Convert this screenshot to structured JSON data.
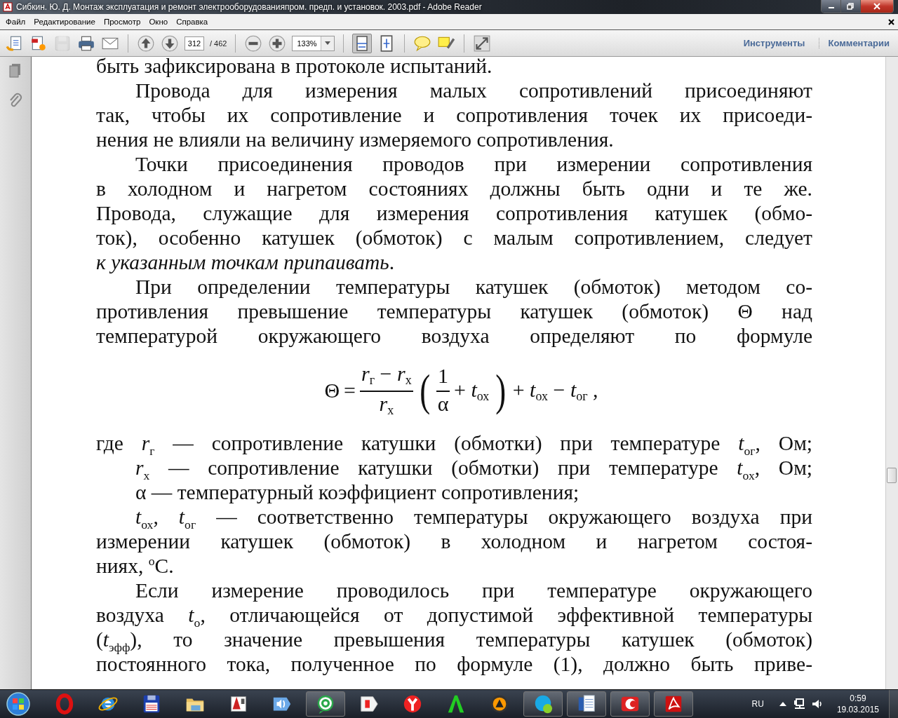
{
  "window": {
    "title": "Сибкин. Ю. Д. Монтаж эксплуатация и ремонт электрооборудованияпром. предп. и установок. 2003.pdf - Adobe Reader"
  },
  "menu": [
    "Файл",
    "Редактирование",
    "Просмотр",
    "Окно",
    "Справка"
  ],
  "toolbar": {
    "file_buttons": [
      {
        "kind": "create",
        "disabled": false
      },
      {
        "kind": "convert",
        "disabled": false
      },
      {
        "kind": "save",
        "disabled": true
      },
      {
        "kind": "print",
        "disabled": false
      },
      {
        "kind": "email",
        "disabled": false
      }
    ],
    "page_number": "312",
    "page_count": "/ 462",
    "zoom": "133%",
    "view_buttons": [
      {
        "kind": "fit-page",
        "selected": true
      },
      {
        "kind": "fit-width",
        "selected": false
      }
    ],
    "comment_buttons": [
      {
        "kind": "comment"
      },
      {
        "kind": "highlight"
      }
    ],
    "panels": [
      "Инструменты",
      "Комментарии"
    ]
  },
  "nav_panel": [
    {
      "kind": "pages"
    },
    {
      "kind": "attachments"
    }
  ],
  "document": [
    {
      "kind": "paragraph",
      "indent": false,
      "ends": true,
      "lines": [
        "быть зафиксирована в протоколе испытаний."
      ]
    },
    {
      "kind": "paragraph",
      "indent": true,
      "ends": true,
      "lines": [
        "Провода для измерения малых сопротивлений присоединяют",
        "так, чтобы их сопротивление и сопротивления точек их присоеди-",
        "нения не влияли на величину измеряемого сопротивления."
      ]
    },
    {
      "kind": "paragraph",
      "indent": true,
      "ends": true,
      "lines": [
        "Точки присоединения проводов при измерении сопротивления",
        "в холодном и нагретом состояниях должны быть одни и те же.",
        "Провода, служащие для измерения сопротивления катушек (обмо-",
        "ток), особенно катушек (обмоток) с малым сопротивлением, следует",
        "*к указанным точкам припаивать*."
      ]
    },
    {
      "kind": "paragraph",
      "indent": true,
      "ends": false,
      "lines": [
        "При определении температуры катушек (обмоток) методом со-",
        "противления превышение температуры катушек (обмоток) Θ над",
        "температурой окружающего воздуха определяют по формуле"
      ]
    },
    {
      "kind": "formula",
      "lhs": "Θ",
      "relation": "=",
      "numerator": "*r*$_{г}$ − *r*$_{x}$",
      "denominator": "*r*$_{x}$",
      "open_paren": "(",
      "inner_numerator": "1",
      "inner_denominator": "α",
      "inner_rest": "+ *t*$_{ох}$",
      "close_paren": ")",
      "rest": "+ *t*$_{ох}$ − *t*$_{ог}$ ,"
    },
    {
      "kind": "paragraph",
      "indent": false,
      "ends": false,
      "lines": [
        "где *r*$_{г}$ — сопротивление катушки (обмотки) при температуре *t*$_{ог}$, Ом;"
      ]
    },
    {
      "kind": "paragraph",
      "indent": true,
      "ends": false,
      "lines": [
        "*r*$_{x}$ — сопротивление катушки (обмотки) при температуре *t*$_{ох}$, Ом;"
      ]
    },
    {
      "kind": "paragraph",
      "indent": true,
      "ends": true,
      "lines": [
        "α — температурный коэффициент сопротивления;"
      ]
    },
    {
      "kind": "paragraph",
      "indent": true,
      "ends": true,
      "lines": [
        "*t*$_{ох}$, *t*$_{ог}$ — соответственно температуры окружающего воздуха при",
        "измерении катушек (обмоток) в холодном и нагретом состоя-",
        "ниях, $^{о}$С."
      ]
    },
    {
      "kind": "paragraph",
      "indent": true,
      "ends": false,
      "lines": [
        "Если измерение проводилось при температуре окружающего",
        "воздуха *t*$_{о}$, отличающейся от допустимой эффективной температуры",
        "(*t*$_{эфф}$), то значение превышения температуры катушек (обмоток)",
        "постоянного тока, полученное по формуле (1), должно быть приве-"
      ]
    }
  ],
  "taskbar": {
    "items": [
      {
        "kind": "opera",
        "open": false
      },
      {
        "kind": "ie",
        "open": false
      },
      {
        "kind": "floppy",
        "open": false
      },
      {
        "kind": "folder",
        "open": false
      },
      {
        "kind": "cad",
        "open": false
      },
      {
        "kind": "speaker",
        "open": false
      },
      {
        "kind": "at",
        "open": true
      },
      {
        "kind": "flag",
        "open": false
      },
      {
        "kind": "yabrowser",
        "open": false
      },
      {
        "kind": "atext",
        "open": false
      },
      {
        "kind": "aimp",
        "open": false
      },
      {
        "kind": "skype",
        "open": true
      },
      {
        "kind": "word",
        "open": true
      },
      {
        "kind": "scan",
        "open": true
      },
      {
        "kind": "pdf",
        "open": true
      }
    ],
    "language": "RU",
    "time": "0:59",
    "date": "19.03.2015"
  }
}
